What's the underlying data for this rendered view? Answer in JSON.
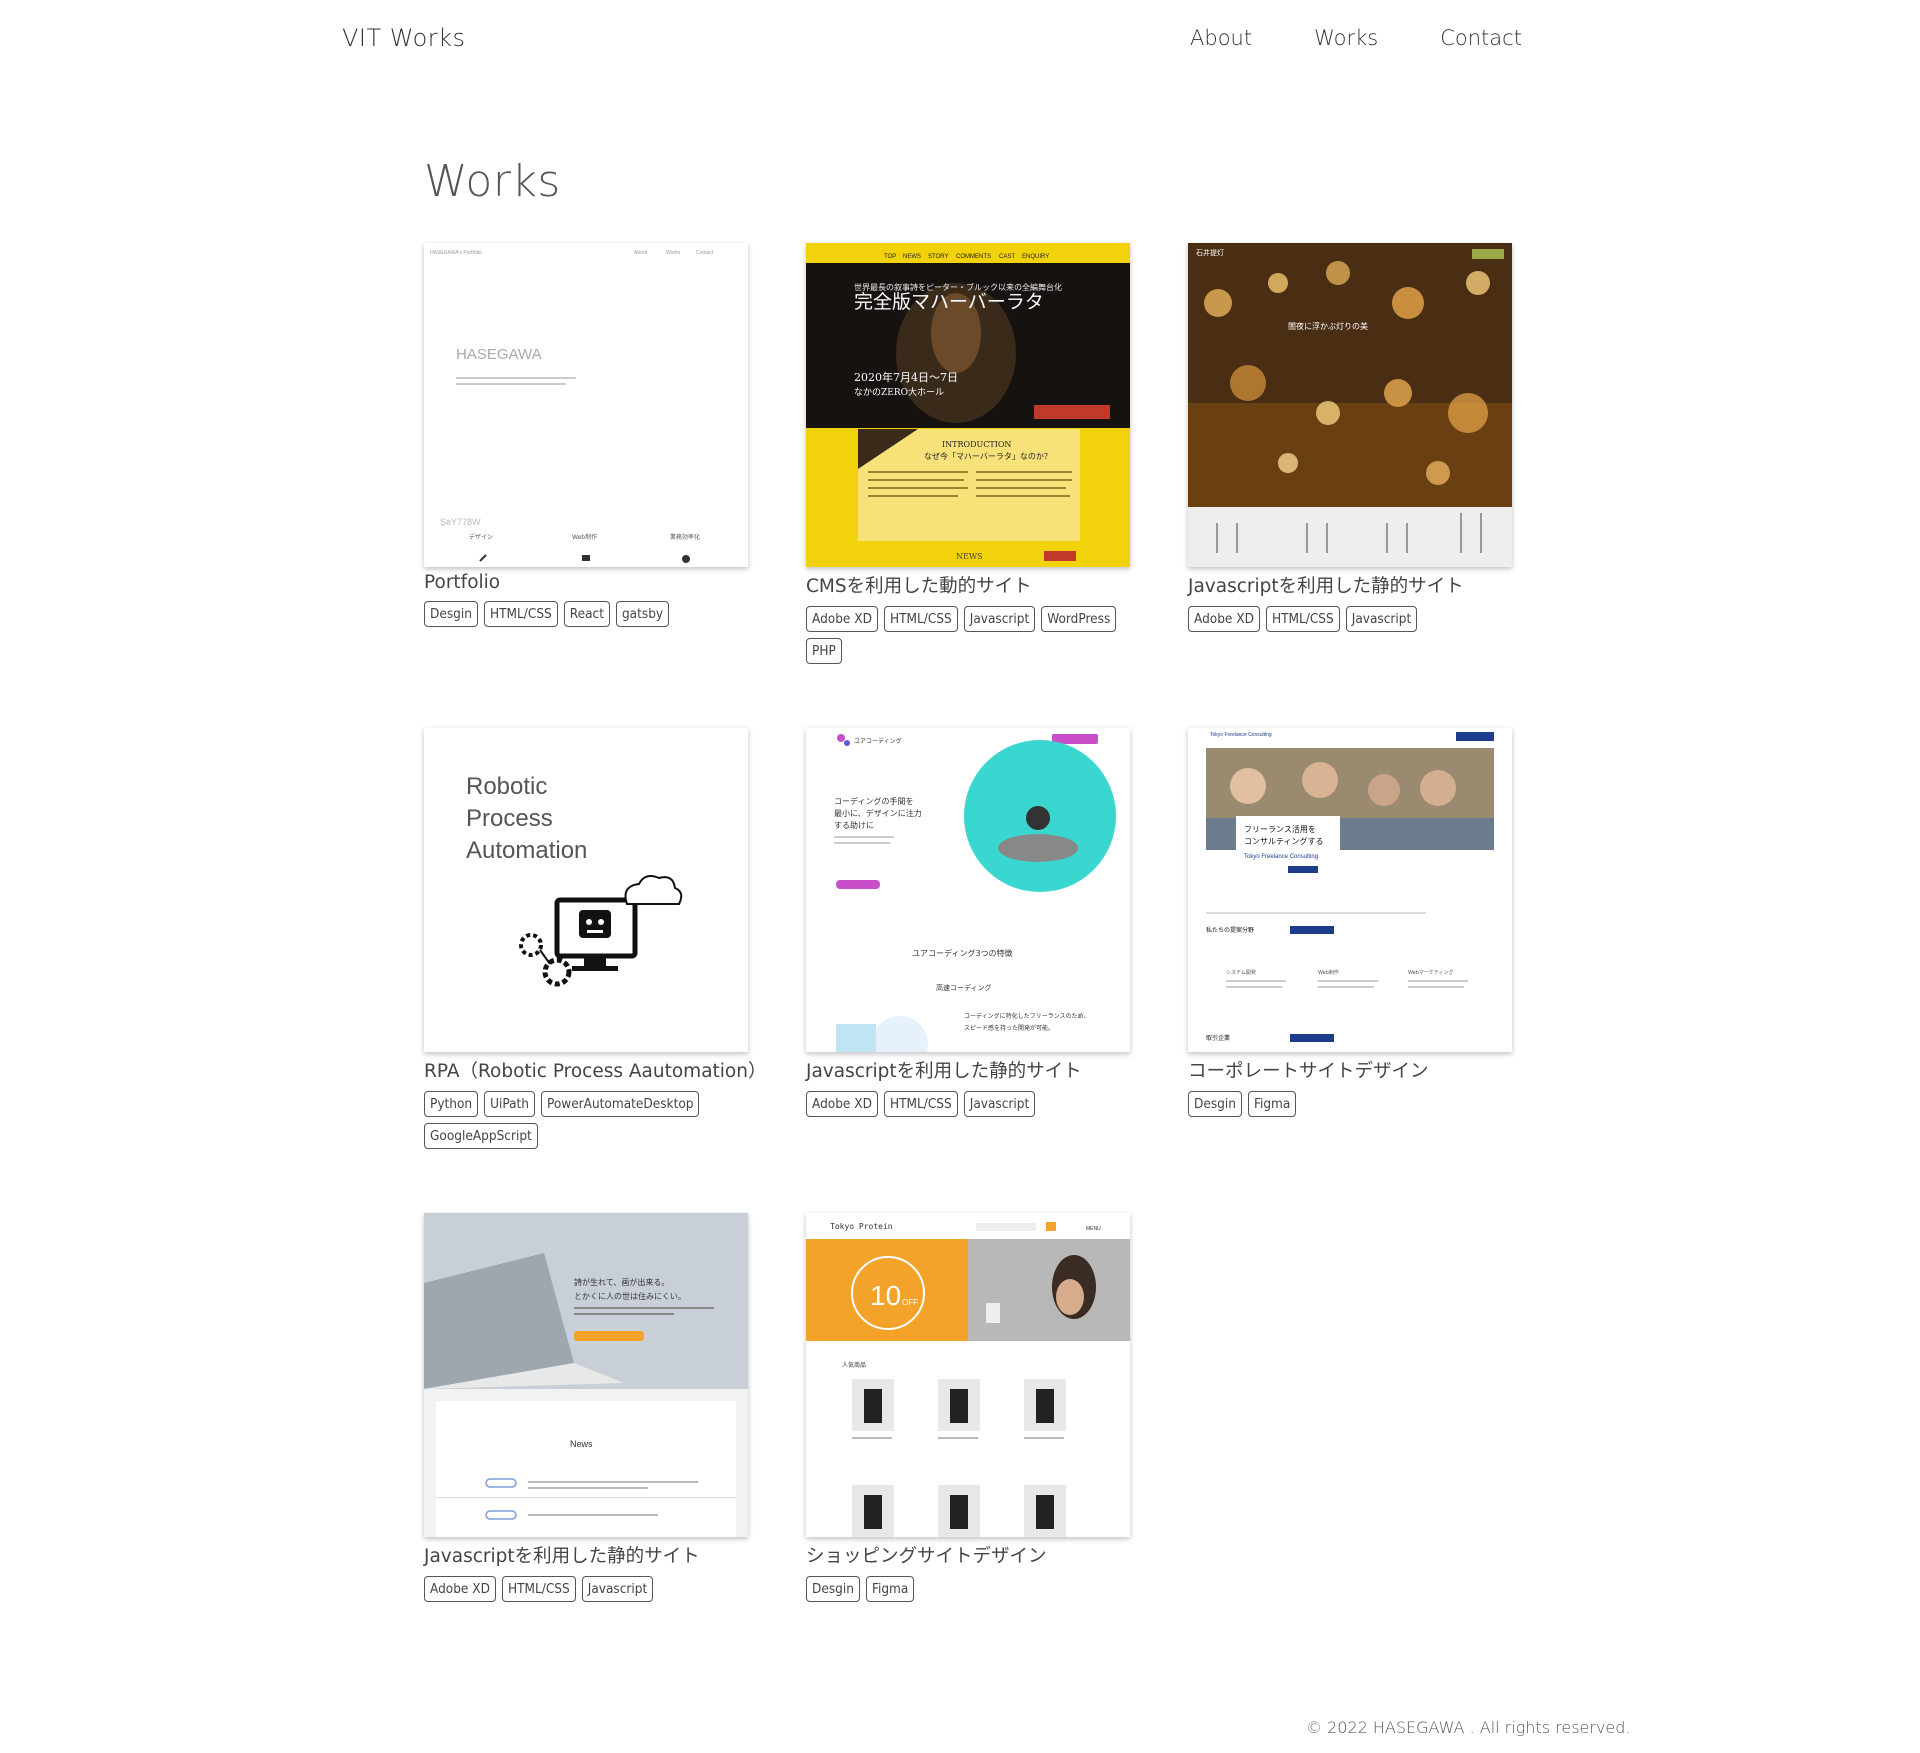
{
  "header": {
    "logo": "VIT Works",
    "nav": [
      "About",
      "Works",
      "Contact"
    ]
  },
  "page": {
    "title": "Works"
  },
  "works": [
    {
      "title": "Portfolio",
      "tags": [
        "Desgin",
        "HTML/CSS",
        "React",
        "gatsby"
      ],
      "thumb": {
        "brand": "HASEGAWA's Portfolio",
        "nav": [
          "About",
          "Works",
          "Contact"
        ],
        "heading": "HASEGAWA",
        "sub": "SeY778W",
        "items": [
          "デザイン",
          "Web制作",
          "業務効率化"
        ]
      }
    },
    {
      "title": "CMSを利用した動的サイト",
      "tags": [
        "Adobe XD",
        "HTML/CSS",
        "Javascript",
        "WordPress",
        "PHP"
      ],
      "thumb": {
        "nav": [
          "TOP",
          "NEWS",
          "STORY",
          "COMMENTS",
          "CAST",
          "ENQUIRY"
        ],
        "heading1": "世界最長の叙事詩をピーター・ブルック以来の全編舞台化",
        "heading2": "完全版マハーバーラタ",
        "date": "2020年7月4日～7日",
        "venue": "なかのZERO大ホール",
        "intro": "INTRODUCTION",
        "intro_q": "なぜ今「マハーバーラタ」なのか？",
        "news": "NEWS"
      }
    },
    {
      "title": "Javascriptを利用した静的サイト",
      "tags": [
        "Adobe XD",
        "HTML/CSS",
        "Javascript"
      ],
      "thumb": {
        "brand": "石井提灯",
        "caption": "闇夜に浮かぶ灯りの美"
      }
    },
    {
      "title": "RPA（Robotic Process Aautomation）",
      "tags": [
        "Python",
        "UiPath",
        "PowerAutomateDesktop",
        "GoogleAppScript"
      ],
      "thumb": {
        "line1": "Robotic",
        "line2": "Process",
        "line3": "Automation"
      }
    },
    {
      "title": "Javascriptを利用した静的サイト",
      "tags": [
        "Adobe XD",
        "HTML/CSS",
        "Javascript"
      ],
      "thumb": {
        "brand": "ユアコーディング",
        "hero1": "コーディングの手間を",
        "hero2": "最小に、デザインに注力",
        "hero3": "する助けに",
        "section": "ユアコーディング3つの特徴",
        "feature": "高速コーディング",
        "desc1": "コーディングに特化したフリーランスのため、",
        "desc2": "スピード感を持った開発が可能。"
      }
    },
    {
      "title": "コーポレートサイトデザイン",
      "tags": [
        "Desgin",
        "Figma"
      ],
      "thumb": {
        "brand": "Tokyo Freelance Consulting",
        "hero1": "フリーランス活用を",
        "hero2": "コンサルティングする",
        "hero3": "Tokyo Freelance Consulting",
        "section1": "私たちの提案分野",
        "section2": "取引企業",
        "cols": [
          "システム開発",
          "Web制作",
          "Webマーケティング"
        ]
      }
    },
    {
      "title": "Javascriptを利用した静的サイト",
      "tags": [
        "Adobe XD",
        "HTML/CSS",
        "Javascript"
      ],
      "thumb": {
        "hero1": "詩が生れて、画が出来る。",
        "hero2": "とかくに人の世は住みにくい。",
        "news": "News"
      }
    },
    {
      "title": "ショッピングサイトデザイン",
      "tags": [
        "Desgin",
        "Figma"
      ],
      "thumb": {
        "brand": "Tokyo Protein",
        "menu": "MENU",
        "sale": "10",
        "off": "OFF",
        "section": "人気商品"
      }
    }
  ],
  "footer": {
    "copyright": "© 2022 HASEGAWA . All rights reserved."
  },
  "colors": {
    "text": "#333333",
    "tag_border": "#555555",
    "yellow": "#f2d20a",
    "accent_red": "#c0392b",
    "navy": "#1f3c8c",
    "orange": "#f3a32a",
    "teal": "#3ad6d0"
  }
}
